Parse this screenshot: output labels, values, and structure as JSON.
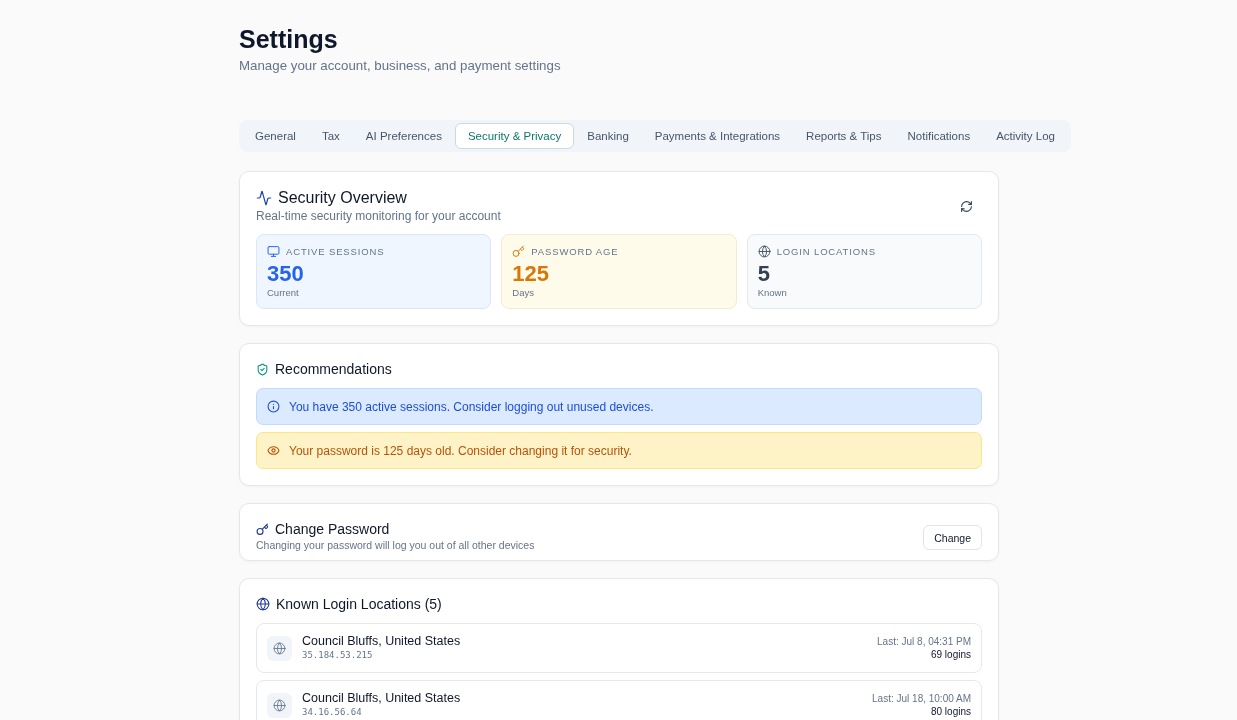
{
  "page": {
    "title": "Settings",
    "subtitle": "Manage your account, business, and payment settings"
  },
  "tabs": [
    {
      "label": "General",
      "selected": false
    },
    {
      "label": "Tax",
      "selected": false
    },
    {
      "label": "AI Preferences",
      "selected": false
    },
    {
      "label": "Security & Privacy",
      "selected": true
    },
    {
      "label": "Banking",
      "selected": false
    },
    {
      "label": "Payments & Integrations",
      "selected": false
    },
    {
      "label": "Reports & Tips",
      "selected": false
    },
    {
      "label": "Notifications",
      "selected": false
    },
    {
      "label": "Activity Log",
      "selected": false
    }
  ],
  "security_overview": {
    "title": "Security Overview",
    "subtitle": "Real-time security monitoring for your account",
    "stats": [
      {
        "kind": "sessions",
        "label": "ACTIVE SESSIONS",
        "value": "350",
        "caption": "Current"
      },
      {
        "kind": "password",
        "label": "PASSWORD AGE",
        "value": "125",
        "caption": "Days"
      },
      {
        "kind": "locations",
        "label": "LOGIN LOCATIONS",
        "value": "5",
        "caption": "Known"
      }
    ]
  },
  "recommendations": {
    "title": "Recommendations",
    "alerts": [
      {
        "kind": "info",
        "text": "You have 350 active sessions. Consider logging out unused devices."
      },
      {
        "kind": "warning",
        "text": "Your password is 125 days old. Consider changing it for security."
      }
    ]
  },
  "change_password": {
    "title": "Change Password",
    "description": "Changing your password will log you out of all other devices",
    "button": "Change"
  },
  "login_locations": {
    "title": "Known Login Locations (5)",
    "locations": [
      {
        "place": "Council Bluffs, United States",
        "ip": "35.184.53.215",
        "last_seen": "Last: Jul 8, 04:31 PM",
        "count": "69 logins"
      },
      {
        "place": "Council Bluffs, United States",
        "ip": "34.16.56.64",
        "last_seen": "Last: Jul 18, 10:00 AM",
        "count": "80 logins"
      }
    ]
  }
}
